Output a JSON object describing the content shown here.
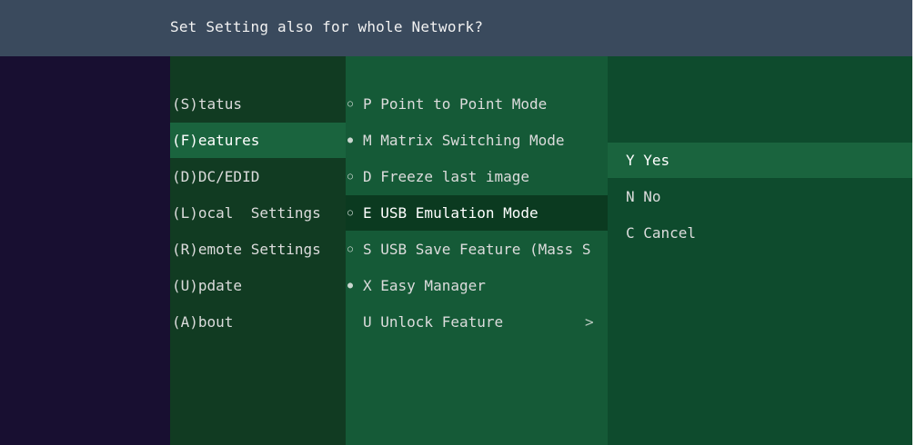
{
  "header": {
    "title": "Set Setting also for whole Network?"
  },
  "main_menu": {
    "items": [
      {
        "label": "(S)tatus"
      },
      {
        "label": "(F)eatures"
      },
      {
        "label": "(D)DC/EDID"
      },
      {
        "label": "(L)ocal  Settings"
      },
      {
        "label": "(R)emote Settings"
      },
      {
        "label": "(U)pdate"
      },
      {
        "label": "(A)bout"
      }
    ],
    "selected": "(F)eatures"
  },
  "features_menu": {
    "items": [
      {
        "bullet": "○",
        "label": "P Point to Point Mode"
      },
      {
        "bullet": "●",
        "label": "M Matrix Switching Mode"
      },
      {
        "bullet": "○",
        "label": "D Freeze last image"
      },
      {
        "bullet": "○",
        "label": "E USB Emulation Mode"
      },
      {
        "bullet": "○",
        "label": "S USB Save Feature (Mass S"
      },
      {
        "bullet": "●",
        "label": "X Easy Manager"
      },
      {
        "bullet": "",
        "label": "U Unlock Feature",
        "arrow": ">"
      }
    ],
    "selected": "E USB Emulation Mode"
  },
  "confirm_menu": {
    "items": [
      {
        "label": "Y Yes"
      },
      {
        "label": "N No"
      },
      {
        "label": "C Cancel"
      }
    ],
    "selected": "Y Yes"
  },
  "colors": {
    "header_bg": "#3a4a5d",
    "left_pane_bg": "#180f31",
    "menu1_bg": "#113b22",
    "menu2_bg": "#155a37",
    "menu3_bg": "#0e4b2d",
    "selection_bg": "#1a643e"
  }
}
